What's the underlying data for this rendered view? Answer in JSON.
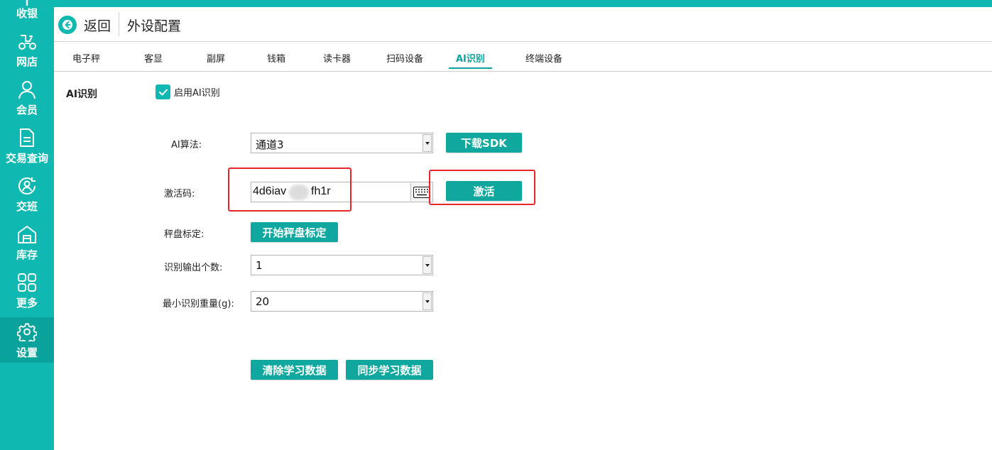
{
  "sidebar": {
    "items": [
      {
        "label": "收银",
        "icon": "cashier-icon"
      },
      {
        "label": "网店",
        "icon": "scooter-icon"
      },
      {
        "label": "会员",
        "icon": "user-icon"
      },
      {
        "label": "交易查询",
        "icon": "document-icon"
      },
      {
        "label": "交班",
        "icon": "shift-icon"
      },
      {
        "label": "库存",
        "icon": "warehouse-icon"
      },
      {
        "label": "更多",
        "icon": "grid-icon"
      },
      {
        "label": "设置",
        "icon": "gear-icon"
      }
    ],
    "active": "设置"
  },
  "header": {
    "back_label": "返回",
    "title": "外设配置"
  },
  "tabs": [
    {
      "label": "电子秤"
    },
    {
      "label": "客显"
    },
    {
      "label": "副屏"
    },
    {
      "label": "钱箱"
    },
    {
      "label": "读卡器"
    },
    {
      "label": "扫码设备"
    },
    {
      "label": "AI识别"
    },
    {
      "label": "终端设备"
    }
  ],
  "active_tab": "AI识别",
  "main": {
    "section_label": "AI识别",
    "enable_checkbox": {
      "label": "启用AI识别",
      "checked": true
    },
    "algorithm": {
      "label": "AI算法:",
      "value": "通道3"
    },
    "download_sdk_label": "下载SDK",
    "activation_code": {
      "label": "激活码:",
      "value_start": "4d6iav",
      "value_end": "fh1r"
    },
    "activate_label": "激活",
    "calibration": {
      "label": "秤盘标定:",
      "button_label": "开始秤盘标定"
    },
    "output_count": {
      "label": "识别输出个数:",
      "value": "1"
    },
    "min_weight": {
      "label": "最小识别重量(g):",
      "value": "20"
    },
    "clear_label": "清除学习数据",
    "sync_label": "同步学习数据"
  },
  "colors": {
    "brand": "#0fb9b1",
    "button": "#0fa79e",
    "active_tab": "#0aa39c",
    "highlight_box": "#e8262a"
  }
}
